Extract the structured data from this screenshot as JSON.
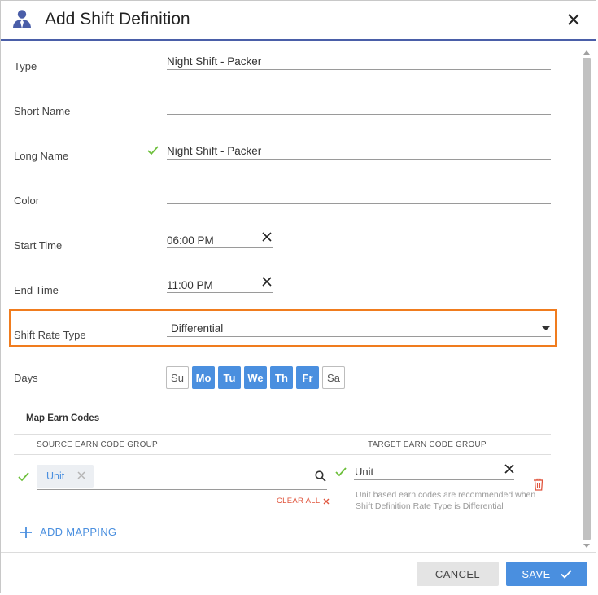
{
  "dialog": {
    "title": "Add Shift Definition",
    "icon": "person-icon",
    "close_icon": "close-icon"
  },
  "fields": {
    "type": {
      "label": "Type",
      "value": "Night Shift - Packer"
    },
    "short_name": {
      "label": "Short Name",
      "value": ""
    },
    "long_name": {
      "label": "Long Name",
      "value": "Night Shift - Packer",
      "valid": true
    },
    "color": {
      "label": "Color",
      "value": ""
    },
    "start_time": {
      "label": "Start Time",
      "value": "06:00 PM"
    },
    "end_time": {
      "label": "End Time",
      "value": "11:00 PM"
    },
    "shift_rate_type": {
      "label": "Shift Rate Type",
      "value": "Differential"
    }
  },
  "days": {
    "label": "Days",
    "items": [
      {
        "label": "Su",
        "selected": false
      },
      {
        "label": "Mo",
        "selected": true
      },
      {
        "label": "Tu",
        "selected": true
      },
      {
        "label": "We",
        "selected": true
      },
      {
        "label": "Th",
        "selected": true
      },
      {
        "label": "Fr",
        "selected": true
      },
      {
        "label": "Sa",
        "selected": false
      }
    ]
  },
  "mapping": {
    "section_title": "Map Earn Codes",
    "source_header": "SOURCE EARN CODE GROUP",
    "target_header": "TARGET EARN CODE GROUP",
    "rows": [
      {
        "source_chip": "Unit",
        "clear_all": "CLEAR ALL",
        "target_value": "Unit",
        "hint": "Unit based earn codes are recommended when Shift Definition Rate Type is Differential"
      }
    ],
    "add_label": "ADD MAPPING"
  },
  "footer": {
    "cancel_label": "CANCEL",
    "save_label": "SAVE"
  },
  "colors": {
    "accent": "#4a8fdf",
    "header_rule": "#4a5ea8",
    "highlight": "#f07c1e",
    "valid": "#6cbf3a",
    "danger": "#e0553d"
  }
}
